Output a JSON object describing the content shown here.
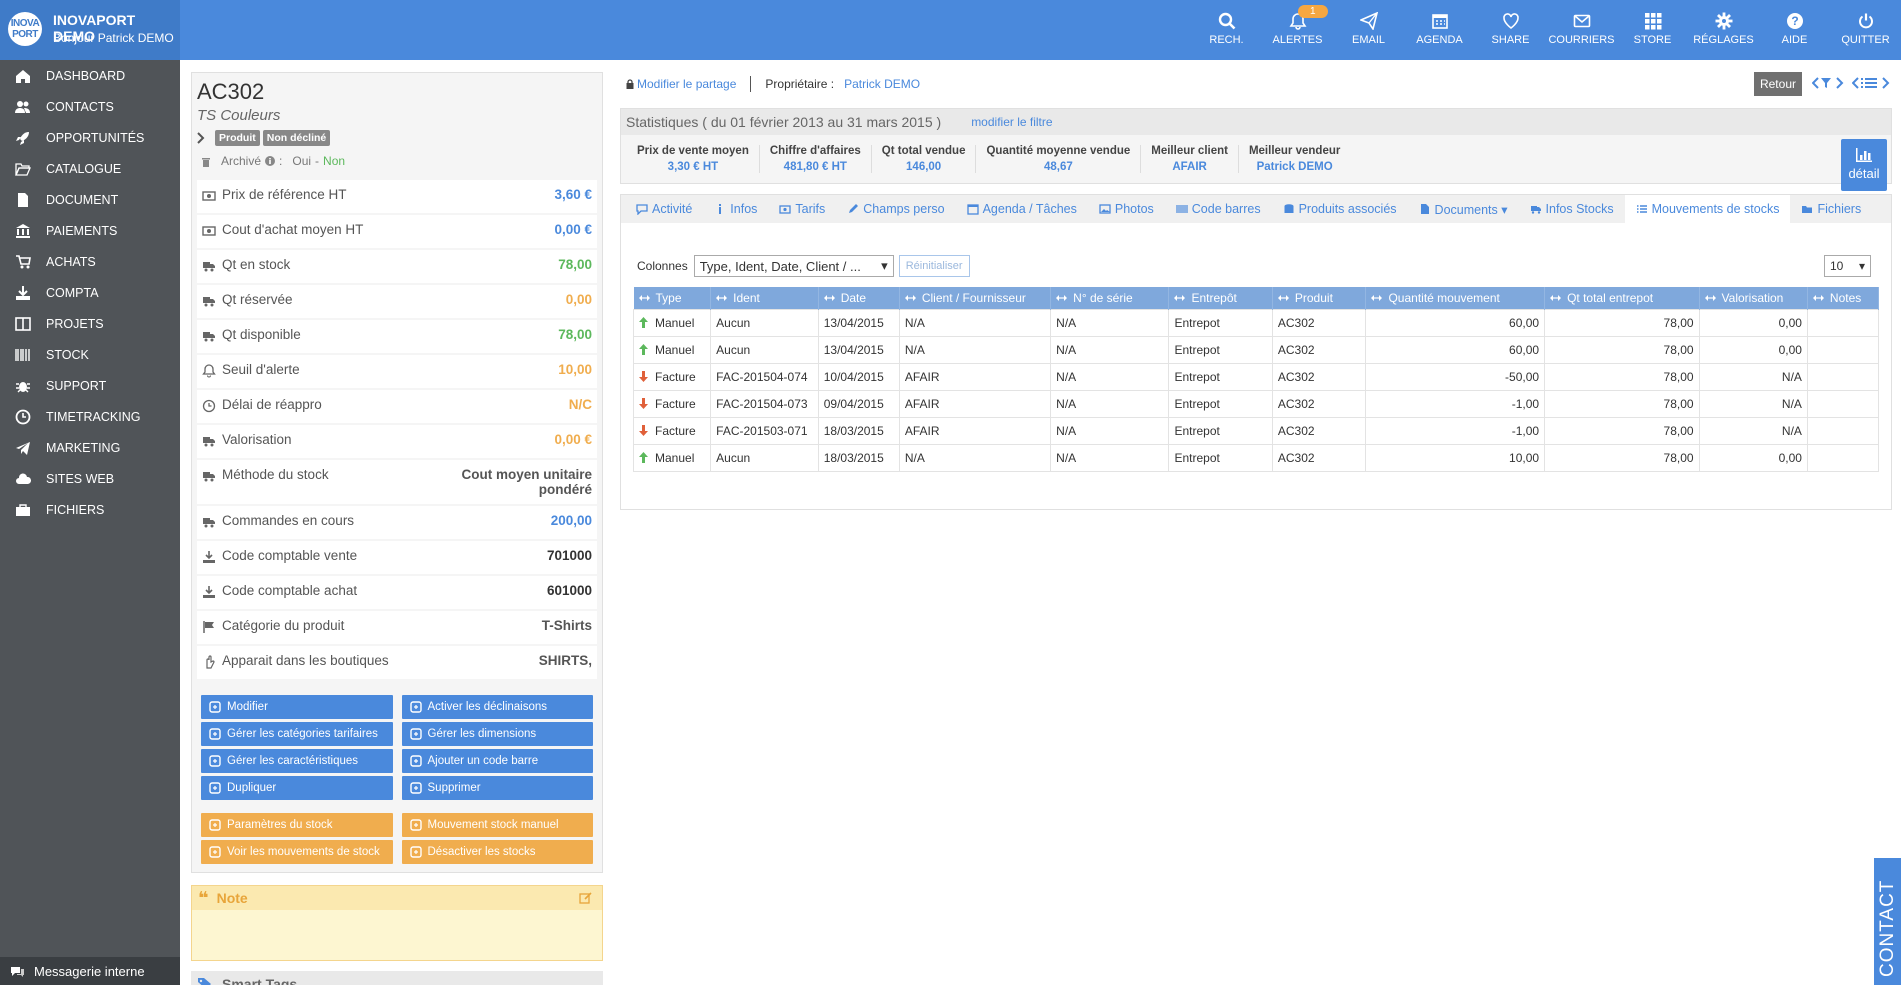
{
  "brand": {
    "title": "INOVAPORT DEMO",
    "subtitle": "Bonjour Patrick DEMO",
    "logo_line1": "INOVA",
    "logo_line2": "PORT"
  },
  "topnav": [
    {
      "key": "search",
      "label": "RECH."
    },
    {
      "key": "bell",
      "label": "ALERTES",
      "badge": "1"
    },
    {
      "key": "send",
      "label": "EMAIL"
    },
    {
      "key": "calendar",
      "label": "AGENDA"
    },
    {
      "key": "heart",
      "label": "SHARE"
    },
    {
      "key": "mail",
      "label": "COURRIERS"
    },
    {
      "key": "grid",
      "label": "STORE"
    },
    {
      "key": "gear",
      "label": "RÉGLAGES"
    },
    {
      "key": "help",
      "label": "AIDE"
    },
    {
      "key": "power",
      "label": "QUITTER"
    }
  ],
  "sidebar": {
    "items": [
      "DASHBOARD",
      "CONTACTS",
      "OPPORTUNITÉS",
      "CATALOGUE",
      "DOCUMENT",
      "PAIEMENTS",
      "ACHATS",
      "COMPTA",
      "PROJETS",
      "STOCK",
      "SUPPORT",
      "TIMETRACKING",
      "MARKETING",
      "SITES WEB",
      "FICHIERS"
    ],
    "messaging": "Messagerie interne"
  },
  "product": {
    "code": "AC302",
    "name": "TS Couleurs",
    "tags": [
      "Produit",
      "Non décliné"
    ],
    "archived_label": "Archivé",
    "colon": ":",
    "archived_yes": "Oui",
    "archived_sep": "-",
    "archived_no": "Non"
  },
  "properties": [
    {
      "label": "Prix de référence HT",
      "value": "3,60 €",
      "color": "#4a89dc"
    },
    {
      "label": "Cout d'achat moyen HT",
      "value": "0,00 €",
      "color": "#4a89dc"
    },
    {
      "label": "Qt en stock",
      "value": "78,00",
      "color": "#5cb85c"
    },
    {
      "label": "Qt réservée",
      "value": "0,00",
      "color": "#f0ad4e"
    },
    {
      "label": "Qt disponible",
      "value": "78,00",
      "color": "#5cb85c"
    },
    {
      "label": "Seuil d'alerte",
      "value": "10,00",
      "color": "#f0ad4e"
    },
    {
      "label": "Délai de réappro",
      "value": "N/C",
      "color": "#f0ad4e"
    },
    {
      "label": "Valorisation",
      "value": "0,00 €",
      "color": "#f0ad4e"
    },
    {
      "label": "Méthode du stock",
      "value": "Cout moyen unitaire pondéré",
      "color": "#555"
    },
    {
      "label": "Commandes en cours",
      "value": "200,00",
      "color": "#4a89dc"
    },
    {
      "label": "Code comptable vente",
      "value": "701000",
      "color": "#333"
    },
    {
      "label": "Code comptable achat",
      "value": "601000",
      "color": "#333"
    },
    {
      "label": "Catégorie du produit",
      "value": "T-Shirts",
      "color": "#555"
    },
    {
      "label": "Apparait dans les boutiques",
      "value": "SHIRTS,",
      "color": "#555"
    }
  ],
  "actions_blue": [
    "Modifier",
    "Activer les déclinaisons",
    "Gérer les catégories tarifaires",
    "Gérer les dimensions",
    "Gérer les caractéristiques",
    "Ajouter un code barre",
    "Dupliquer",
    "Supprimer"
  ],
  "actions_orange": [
    "Paramètres du stock",
    "Mouvement stock manuel",
    "Voir les mouvements de stock",
    "Désactiver les stocks"
  ],
  "note": {
    "title": "Note"
  },
  "smart_tags": {
    "title": "Smart Tags"
  },
  "share": {
    "modify_link": "Modifier le partage",
    "owner_label": "Propriétaire :",
    "owner": "Patrick DEMO",
    "back": "Retour"
  },
  "stats": {
    "title": "Statistiques ( du 01 février 2013 au 31 mars 2015 )",
    "filter_link": "modifier le filtre",
    "detail": "détail",
    "items": [
      {
        "label": "Prix de vente moyen",
        "value": "3,30 € HT"
      },
      {
        "label": "Chiffre d'affaires",
        "value": "481,80 € HT"
      },
      {
        "label": "Qt total vendue",
        "value": "146,00"
      },
      {
        "label": "Quantité moyenne vendue",
        "value": "48,67"
      },
      {
        "label": "Meilleur client",
        "value": "AFAIR"
      },
      {
        "label": "Meilleur vendeur",
        "value": "Patrick DEMO"
      }
    ]
  },
  "tabs": [
    {
      "icon": "comment",
      "label": "Activité"
    },
    {
      "icon": "info",
      "label": "Infos"
    },
    {
      "icon": "money",
      "label": "Tarifs"
    },
    {
      "icon": "pencil",
      "label": "Champs perso"
    },
    {
      "icon": "calendar",
      "label": "Agenda / Tâches"
    },
    {
      "icon": "image",
      "label": "Photos"
    },
    {
      "icon": "barcode",
      "label": "Code barres"
    },
    {
      "icon": "database",
      "label": "Produits associés"
    },
    {
      "icon": "file",
      "label": "Documents ▾"
    },
    {
      "icon": "truck",
      "label": "Infos Stocks"
    },
    {
      "icon": "list",
      "label": "Mouvements de stocks",
      "active": true
    },
    {
      "icon": "folder",
      "label": "Fichiers"
    }
  ],
  "table_controls": {
    "columns_label": "Colonnes",
    "columns_value": "Type, Ident, Date, Client / ...",
    "reset": "Réinitialiser",
    "page_size": "10"
  },
  "table": {
    "headers": [
      "Type",
      "Ident",
      "Date",
      "Client / Fournisseur",
      "N° de série",
      "Entrepôt",
      "Produit",
      "Quantité mouvement",
      "Qt total entrepot",
      "Valorisation",
      "Notes"
    ],
    "rows": [
      {
        "dir": "up",
        "type": "Manuel",
        "ident": "Aucun",
        "date": "13/04/2015",
        "client": "N/A",
        "serial": "N/A",
        "warehouse": "Entrepot",
        "product": "AC302",
        "qty": "60,00",
        "total": "78,00",
        "val": "0,00",
        "notes": ""
      },
      {
        "dir": "up",
        "type": "Manuel",
        "ident": "Aucun",
        "date": "13/04/2015",
        "client": "N/A",
        "serial": "N/A",
        "warehouse": "Entrepot",
        "product": "AC302",
        "qty": "60,00",
        "total": "78,00",
        "val": "0,00",
        "notes": ""
      },
      {
        "dir": "down",
        "type": "Facture",
        "ident": "FAC-201504-074",
        "date": "10/04/2015",
        "client": "AFAIR",
        "serial": "N/A",
        "warehouse": "Entrepot",
        "product": "AC302",
        "qty": "-50,00",
        "total": "78,00",
        "val": "N/A",
        "notes": ""
      },
      {
        "dir": "down",
        "type": "Facture",
        "ident": "FAC-201504-073",
        "date": "09/04/2015",
        "client": "AFAIR",
        "serial": "N/A",
        "warehouse": "Entrepot",
        "product": "AC302",
        "qty": "-1,00",
        "total": "78,00",
        "val": "N/A",
        "notes": ""
      },
      {
        "dir": "down",
        "type": "Facture",
        "ident": "FAC-201503-071",
        "date": "18/03/2015",
        "client": "AFAIR",
        "serial": "N/A",
        "warehouse": "Entrepot",
        "product": "AC302",
        "qty": "-1,00",
        "total": "78,00",
        "val": "N/A",
        "notes": ""
      },
      {
        "dir": "up",
        "type": "Manuel",
        "ident": "Aucun",
        "date": "18/03/2015",
        "client": "N/A",
        "serial": "N/A",
        "warehouse": "Entrepot",
        "product": "AC302",
        "qty": "10,00",
        "total": "78,00",
        "val": "0,00",
        "notes": ""
      }
    ]
  },
  "contact_tab": "CONTACT",
  "colors": {
    "primary": "#4a89dc",
    "sidebar": "#505458",
    "orange": "#f0ad4e",
    "green": "#5cb85c",
    "red": "#e0603a"
  }
}
